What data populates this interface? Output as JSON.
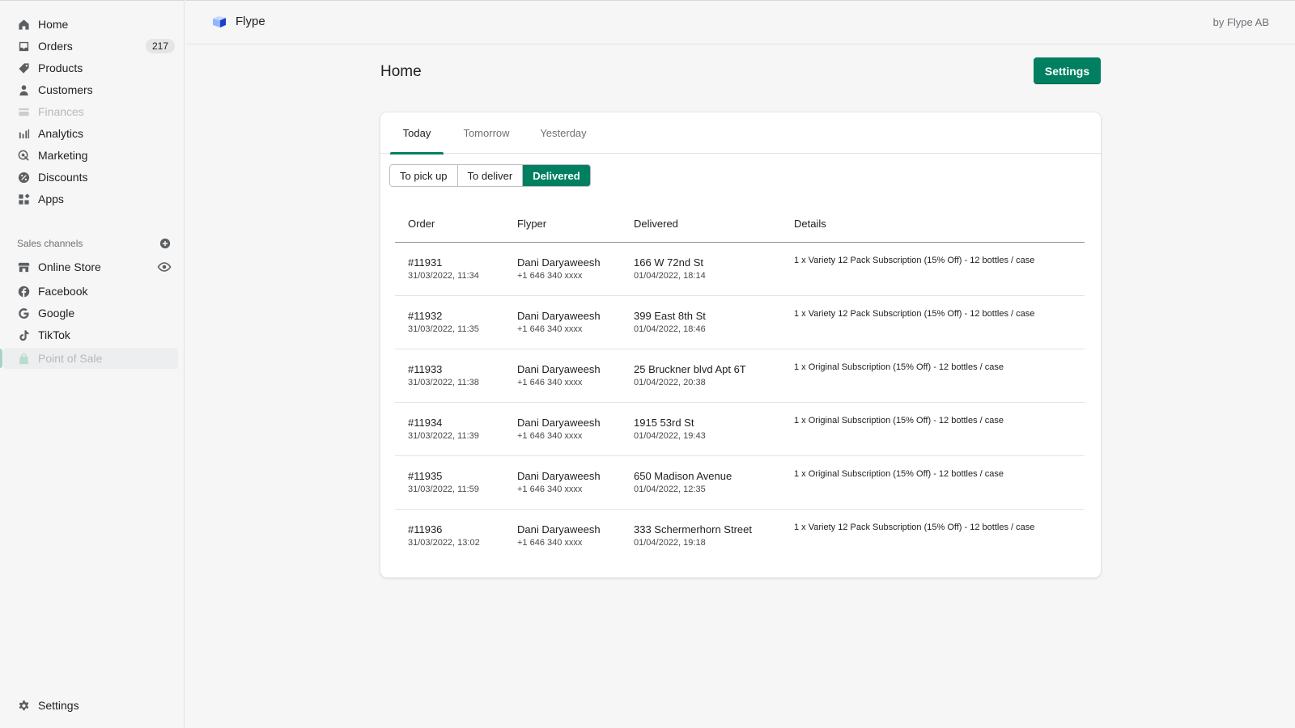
{
  "sidebar": {
    "items": [
      {
        "label": "Home"
      },
      {
        "label": "Orders",
        "badge": "217"
      },
      {
        "label": "Products"
      },
      {
        "label": "Customers"
      },
      {
        "label": "Finances"
      },
      {
        "label": "Analytics"
      },
      {
        "label": "Marketing"
      },
      {
        "label": "Discounts"
      },
      {
        "label": "Apps"
      }
    ],
    "sales_channels_heading": "Sales channels",
    "channels": [
      {
        "label": "Online Store"
      },
      {
        "label": "Facebook"
      },
      {
        "label": "Google"
      },
      {
        "label": "TikTok"
      },
      {
        "label": "Point of Sale"
      }
    ],
    "settings_label": "Settings"
  },
  "topbar": {
    "app_name": "Flype",
    "owner": "by Flype AB"
  },
  "main": {
    "title": "Home",
    "settings_button": "Settings",
    "tabs": [
      {
        "label": "Today",
        "selected": true
      },
      {
        "label": "Tomorrow",
        "selected": false
      },
      {
        "label": "Yesterday",
        "selected": false
      }
    ],
    "filters": [
      {
        "label": "To pick up",
        "selected": false
      },
      {
        "label": "To deliver",
        "selected": false
      },
      {
        "label": "Delivered",
        "selected": true
      }
    ],
    "table": {
      "headers": {
        "order": "Order",
        "flyper": "Flyper",
        "delivered": "Delivered",
        "details": "Details"
      },
      "rows": [
        {
          "order": "#11931",
          "order_time": "31/03/2022, 11:34",
          "flyper": "Dani Daryaweesh",
          "phone": "+1 646 340 xxxx",
          "address": "166 W 72nd St",
          "delivered_time": "01/04/2022, 18:14",
          "details": "1 x Variety 12 Pack Subscription (15% Off) - 12 bottles / case"
        },
        {
          "order": "#11932",
          "order_time": "31/03/2022, 11:35",
          "flyper": "Dani Daryaweesh",
          "phone": "+1 646 340 xxxx",
          "address": "399 East 8th St",
          "delivered_time": "01/04/2022, 18:46",
          "details": "1 x Variety 12 Pack Subscription (15% Off) - 12 bottles / case"
        },
        {
          "order": "#11933",
          "order_time": "31/03/2022, 11:38",
          "flyper": "Dani Daryaweesh",
          "phone": "+1 646 340 xxxx",
          "address": "25 Bruckner blvd Apt 6T",
          "delivered_time": "01/04/2022, 20:38",
          "details": "1 x Original Subscription (15% Off) - 12 bottles / case"
        },
        {
          "order": "#11934",
          "order_time": "31/03/2022, 11:39",
          "flyper": "Dani Daryaweesh",
          "phone": "+1 646 340 xxxx",
          "address": "1915 53rd St",
          "delivered_time": "01/04/2022, 19:43",
          "details": "1 x Original Subscription (15% Off) - 12 bottles / case"
        },
        {
          "order": "#11935",
          "order_time": "31/03/2022, 11:59",
          "flyper": "Dani Daryaweesh",
          "phone": "+1 646 340 xxxx",
          "address": "650 Madison Avenue",
          "delivered_time": "01/04/2022, 12:35",
          "details": "1 x Original Subscription (15% Off) - 12 bottles / case"
        },
        {
          "order": "#11936",
          "order_time": "31/03/2022, 13:02",
          "flyper": "Dani Daryaweesh",
          "phone": "+1 646 340 xxxx",
          "address": "333 Schermerhorn Street",
          "delivered_time": "01/04/2022, 19:18",
          "details": "1 x Variety 12 Pack Subscription (15% Off) - 12 bottles / case"
        }
      ]
    }
  },
  "colors": {
    "accent": "#008060",
    "active_bar": "#a9d3c2"
  }
}
